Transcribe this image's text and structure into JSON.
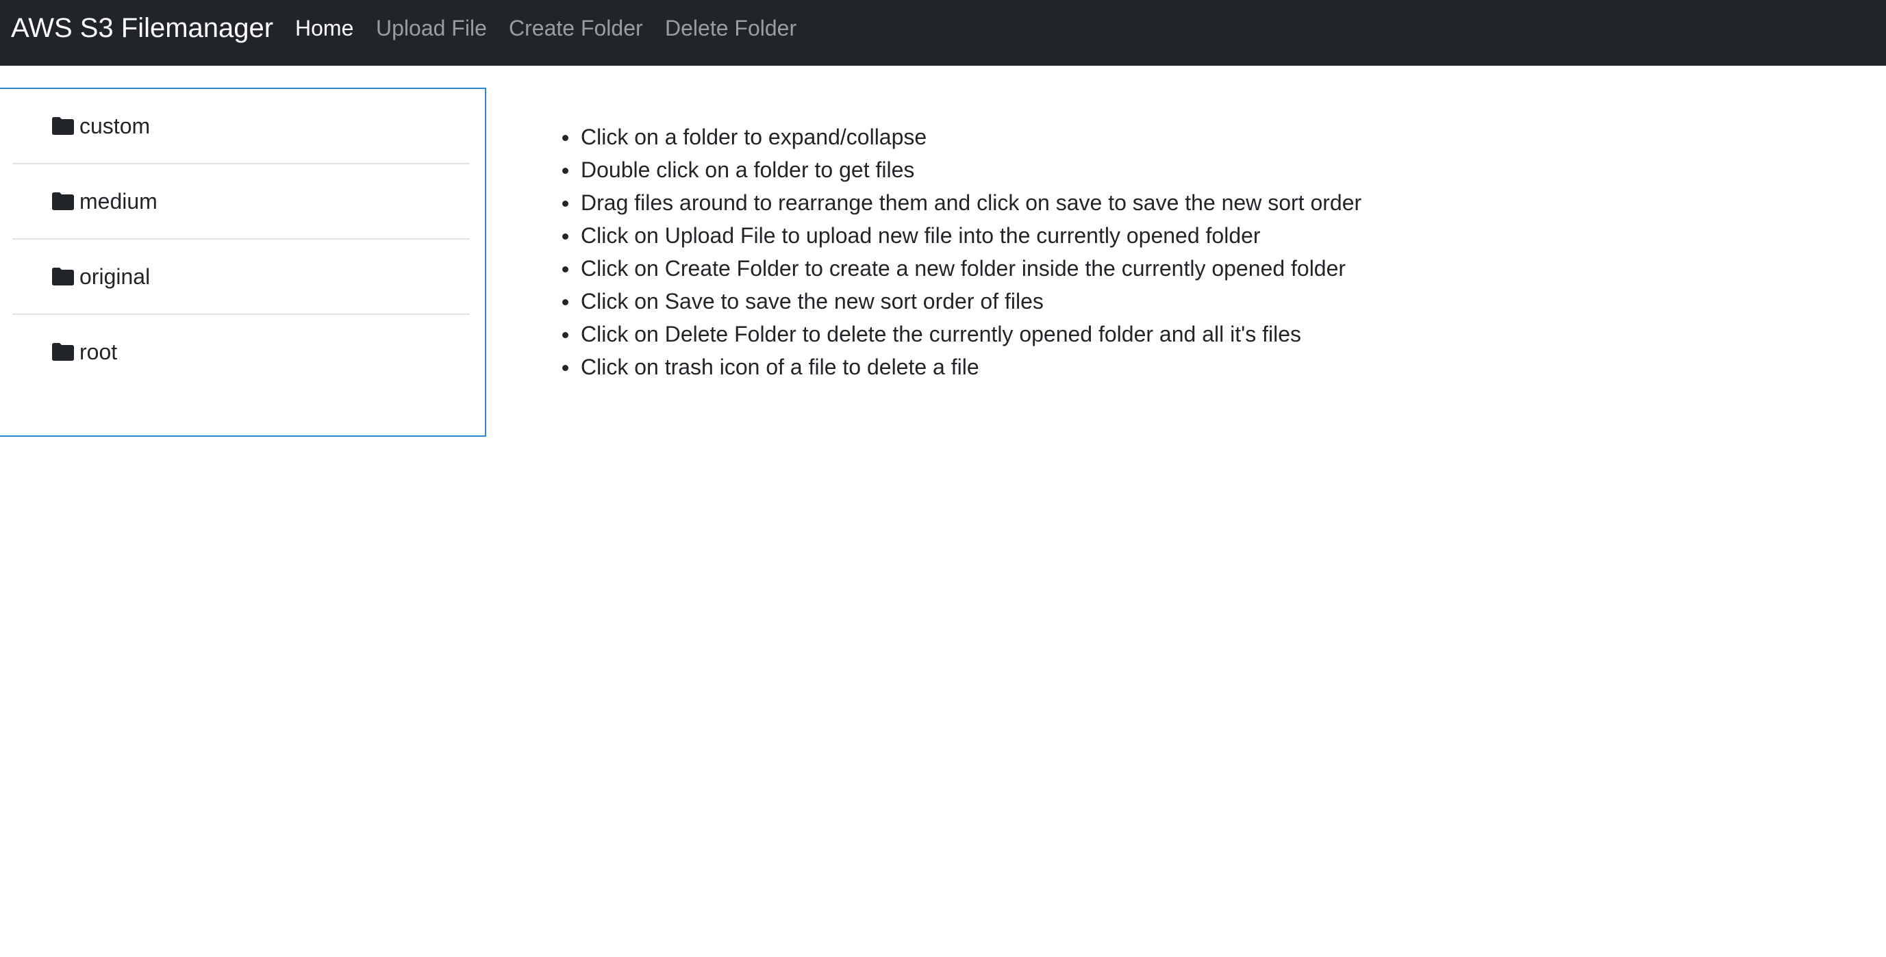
{
  "navbar": {
    "brand": "AWS S3 Filemanager",
    "links": [
      {
        "label": "Home",
        "active": true
      },
      {
        "label": "Upload File",
        "active": false
      },
      {
        "label": "Create Folder",
        "active": false
      },
      {
        "label": "Delete Folder",
        "active": false
      }
    ],
    "background_color": "#212529"
  },
  "folders": {
    "items": [
      {
        "label": "custom",
        "icon": "folder-icon"
      },
      {
        "label": "medium",
        "icon": "folder-icon"
      },
      {
        "label": "original",
        "icon": "folder-icon"
      },
      {
        "label": "root",
        "icon": "folder-icon"
      }
    ],
    "panel_border_color": "#2f86d4"
  },
  "instructions": {
    "items": [
      "Click on a folder to expand/collapse",
      "Double click on a folder to get files",
      "Drag files around to rearrange them and click on save to save the new sort order",
      "Click on Upload File to upload new file into the currently opened folder",
      "Click on Create Folder to create a new folder inside the currently opened folder",
      "Click on Save to save the new sort order of files",
      "Click on Delete Folder to delete the currently opened folder and all it's files",
      "Click on trash icon of a file to delete a file"
    ]
  }
}
